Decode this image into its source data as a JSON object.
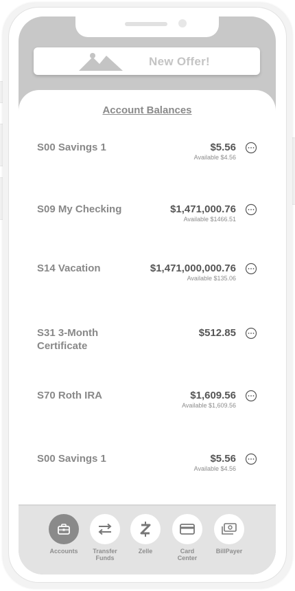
{
  "offer_banner": {
    "text": "New Offer!",
    "icon": "image-placeholder-icon"
  },
  "section_title": "Account Balances",
  "accounts": [
    {
      "name": "S00 Savings 1",
      "balance": "$5.56",
      "available": "Available $4.56"
    },
    {
      "name": "S09 My Checking",
      "balance": "$1,471,000.76",
      "available": "Available $1466.51"
    },
    {
      "name": "S14 Vacation",
      "balance": "$1,471,000,000.76",
      "available": "Available $135.06"
    },
    {
      "name": "S31 3-Month Certificate",
      "balance": "$512.85",
      "available": ""
    },
    {
      "name": "S70 Roth IRA",
      "balance": "$1,609.56",
      "available": "Available $1,609.56"
    },
    {
      "name": "S00 Savings 1",
      "balance": "$5.56",
      "available": "Available $4.56"
    }
  ],
  "more_icon": "more-options-icon",
  "tabs": [
    {
      "label": "Accounts",
      "icon": "briefcase-icon",
      "active": true
    },
    {
      "label": "Transfer\nFunds",
      "icon": "transfer-arrows-icon",
      "active": false
    },
    {
      "label": "Zelle",
      "icon": "zelle-icon",
      "active": false
    },
    {
      "label": "Card\nCenter",
      "icon": "credit-card-icon",
      "active": false
    },
    {
      "label": "BillPayer",
      "icon": "bill-icon",
      "active": false
    }
  ],
  "colors": {
    "screen_gray": "#c8c8c8",
    "tab_bar": "#e3e3e3",
    "active_tab": "#8a8a8a",
    "account_name": "#888888",
    "balance": "#555555"
  }
}
